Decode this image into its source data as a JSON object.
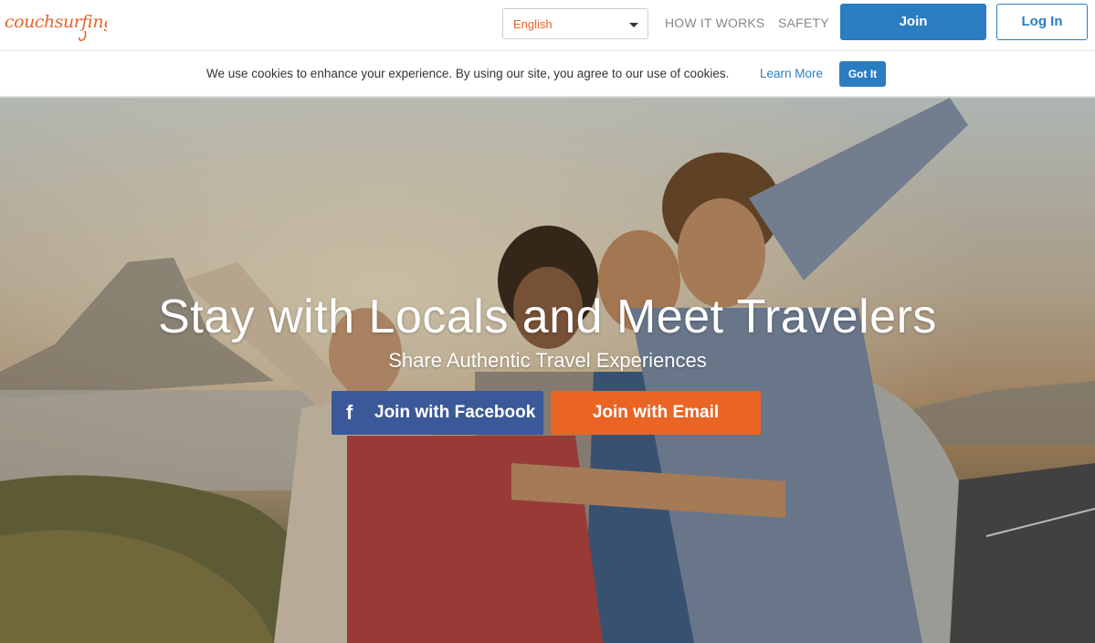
{
  "brand": {
    "logo_text": "couchsurfing",
    "accent": "#e8632b",
    "primary": "#2b7dc2"
  },
  "header": {
    "language": "English",
    "nav": {
      "how_it_works": "HOW IT WORKS",
      "safety": "SAFETY"
    },
    "join_label": "Join",
    "login_label": "Log In"
  },
  "cookie_bar": {
    "message": "We use cookies to enhance your experience. By using our site, you agree to our use of cookies.",
    "learn_more": "Learn More",
    "got_it": "Got It"
  },
  "hero": {
    "title": "Stay with Locals and Meet Travelers",
    "subtitle": "Share Authentic Travel Experiences",
    "facebook_icon": "f",
    "facebook_label": "Join with Facebook",
    "email_label": "Join with Email",
    "facebook_color": "#3b5998",
    "email_color": "#ea6424"
  }
}
